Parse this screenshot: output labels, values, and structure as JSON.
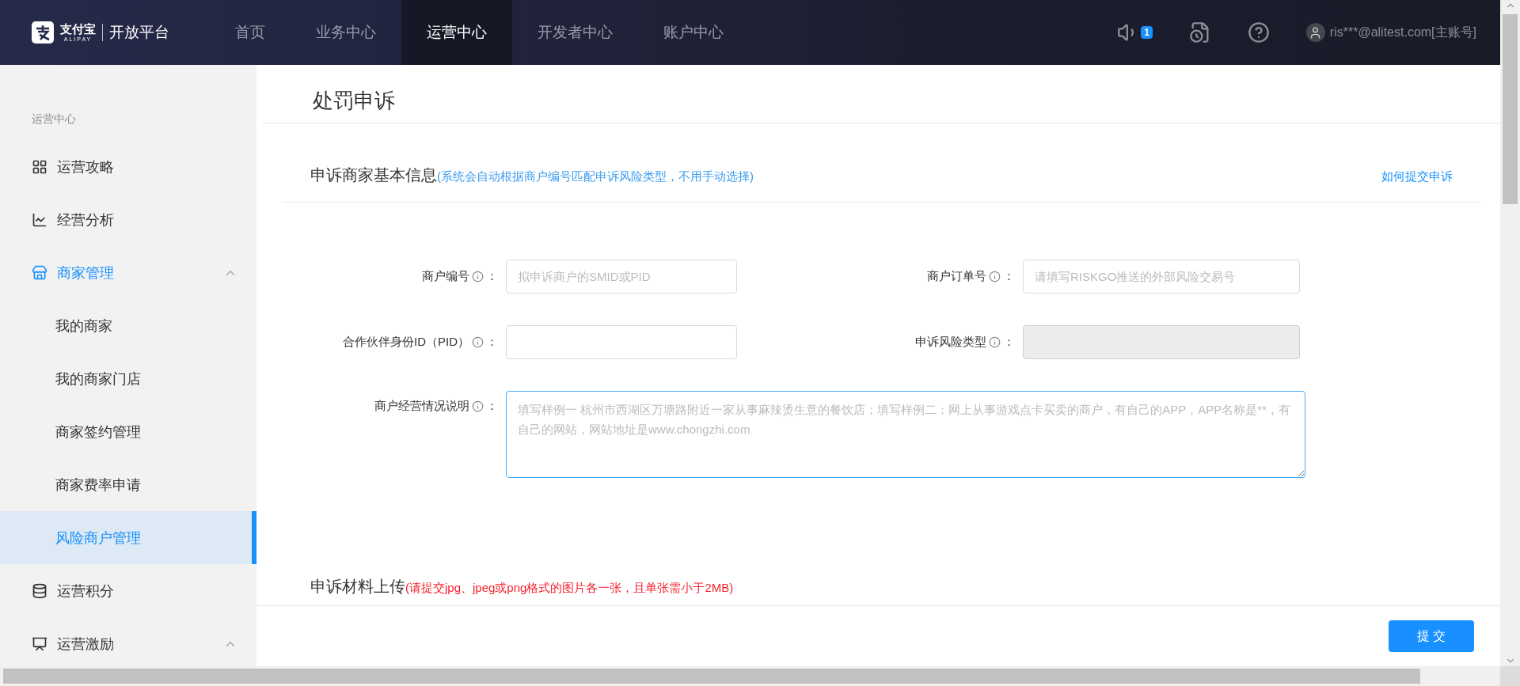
{
  "header": {
    "logo": {
      "brand": "支付宝",
      "brand_en": "ALIPAY",
      "product": "开放平台"
    },
    "nav": [
      {
        "label": "首页",
        "selected": false
      },
      {
        "label": "业务中心",
        "selected": false
      },
      {
        "label": "运营中心",
        "selected": true
      },
      {
        "label": "开发者中心",
        "selected": false
      },
      {
        "label": "账户中心",
        "selected": false
      }
    ],
    "notification_count": "1",
    "user": "ris***@alitest.com[主账号]"
  },
  "sidebar": {
    "title": "运营中心",
    "items": [
      {
        "label": "运营攻略",
        "selected": false
      },
      {
        "label": "经营分析",
        "selected": false
      },
      {
        "label": "商家管理",
        "selected": false,
        "expanded": true,
        "children": [
          {
            "label": "我的商家",
            "selected": false
          },
          {
            "label": "我的商家门店",
            "selected": false
          },
          {
            "label": "商家签约管理",
            "selected": false
          },
          {
            "label": "商家费率申请",
            "selected": false
          },
          {
            "label": "风险商户管理",
            "selected": true
          }
        ]
      },
      {
        "label": "运营积分",
        "selected": false
      },
      {
        "label": "运营激励",
        "selected": false,
        "expanded": true
      }
    ]
  },
  "page": {
    "title": "处罚申诉",
    "sections": [
      {
        "title": "申诉商家基本信息",
        "note": "(系统会自动根据商户编号匹配申诉风险类型，不用手动选择)",
        "color": "#3d9cf0",
        "link": "如何提交申诉",
        "fields": [
          {
            "kind": "input",
            "label": "商户编号",
            "colon": "：",
            "placeholder": "拟申诉商户的SMID或PID",
            "disabled": false
          },
          {
            "kind": "input",
            "label": "商户订单号",
            "colon": "：",
            "placeholder": "请填写RISKGO推送的外部风险交易号",
            "disabled": false
          },
          {
            "kind": "input",
            "label": "合作伙伴身份ID（PID）",
            "colon": "：",
            "disabled": false
          },
          {
            "kind": "input",
            "label": "申诉风险类型",
            "colon": "：",
            "disabled": true
          },
          {
            "kind": "textarea",
            "label": "商户经营情况说明",
            "colon": "：",
            "placeholder": "填写样例一 杭州市西湖区万塘路附近一家从事麻辣烫生意的餐饮店；填写样例二：网上从事游戏点卡买卖的商户，有自己的APP，APP名称是**，有自己的网站，网站地址是www.chongzhi.com",
            "disabled": false
          }
        ]
      },
      {
        "title": "申诉材料上传",
        "note": "(请提交jpg、jpeg或png格式的图片各一张，且单张需小于2MB)",
        "color": "#f5222d"
      }
    ],
    "submit": "提 交"
  }
}
